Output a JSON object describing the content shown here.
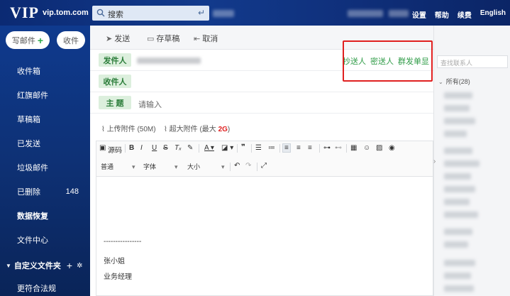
{
  "header": {
    "logo": "VIP",
    "domain": "vip.tom.com",
    "search_placeholder": "搜索",
    "links": [
      "设置",
      "帮助",
      "续费",
      "English"
    ]
  },
  "sidebar": {
    "compose_label": "写邮件",
    "receive_label": "收件",
    "items": [
      {
        "label": "收件箱",
        "count": ""
      },
      {
        "label": "红旗邮件",
        "count": ""
      },
      {
        "label": "草稿箱",
        "count": ""
      },
      {
        "label": "已发送",
        "count": ""
      },
      {
        "label": "垃圾邮件",
        "count": ""
      },
      {
        "label": "已删除",
        "count": "148"
      },
      {
        "label": "数据恢复",
        "count": ""
      },
      {
        "label": "文件中心",
        "count": ""
      }
    ],
    "custom_folder_label": "自定义文件夹",
    "bottom_item": "更符合法规"
  },
  "toolbar": {
    "send": "发送",
    "save_draft": "存草稿",
    "cancel": "取消"
  },
  "compose": {
    "sender_label": "发件人",
    "recipient_label": "收件人",
    "subject_label": "主  题",
    "subject_placeholder": "请输入",
    "cc": "抄送人",
    "bcc": "密送人",
    "group_send": "群发单显",
    "attach": "上传附件 (50M)",
    "super_attach_prefix": "超大附件 (最大 ",
    "super_attach_size": "2G",
    "super_attach_suffix": ")"
  },
  "editor": {
    "source": "源码",
    "format": "普通",
    "font": "字体",
    "size": "大小",
    "sig_dashes": "----------------",
    "sig_name": "张小姐",
    "sig_title": "业务经理"
  },
  "contacts": {
    "search_placeholder": "查找联系人",
    "all_label": "所有(28)"
  },
  "colors": {
    "accent_green": "#2e9b46",
    "highlight_red": "#e02020",
    "sidebar_blue": "#0e3175"
  }
}
